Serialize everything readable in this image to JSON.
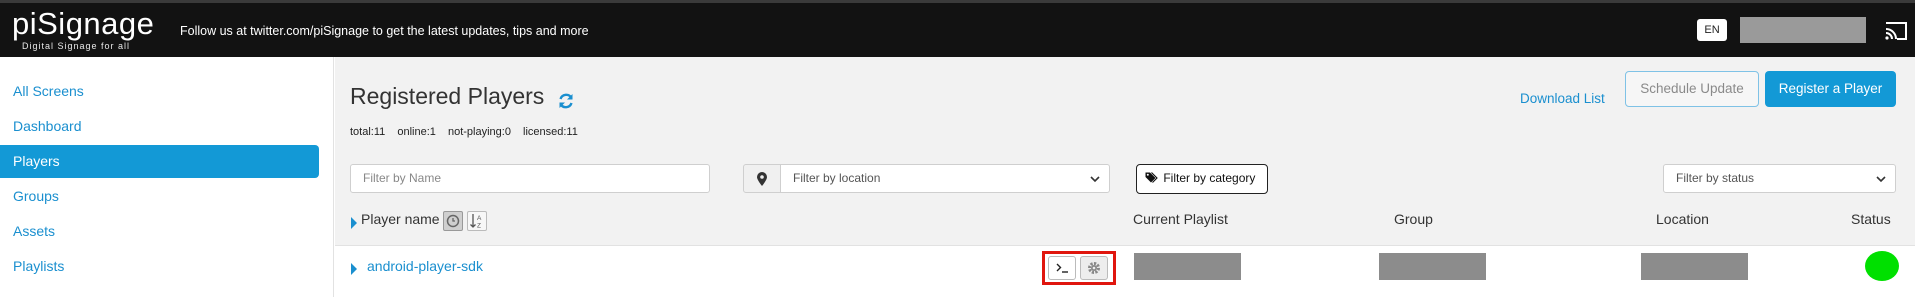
{
  "header": {
    "logo_main": "piSignage",
    "logo_sub": "Digital Signage for all",
    "follow_text": "Follow us at twitter.com/piSignage to get the latest updates, tips and more",
    "language": "EN",
    "cast_icon": "cast-icon"
  },
  "sidebar": {
    "items": [
      {
        "label": "All Screens"
      },
      {
        "label": "Dashboard"
      },
      {
        "label": "Players",
        "active": true
      },
      {
        "label": "Groups"
      },
      {
        "label": "Assets"
      },
      {
        "label": "Playlists"
      }
    ]
  },
  "main": {
    "title": "Registered Players",
    "refresh_icon": "refresh-icon",
    "stats": {
      "total": "total:11",
      "online": "online:1",
      "not_playing": "not-playing:0",
      "licensed": "licensed:11"
    },
    "download_list": "Download List",
    "schedule_update": "Schedule Update",
    "register_player": "Register a Player",
    "filters": {
      "name_placeholder": "Filter by Name",
      "location": "Filter by location",
      "category": "Filter by category",
      "status": "Filter by status"
    },
    "columns": {
      "player_name": "Player name",
      "current_playlist": "Current Playlist",
      "group": "Group",
      "location": "Location",
      "status": "Status"
    },
    "rows": [
      {
        "name": "android-player-sdk",
        "status_color": "#00e000"
      }
    ]
  },
  "colors": {
    "accent": "#1399d6",
    "topbar": "#121212",
    "highlight": "#e0160e",
    "online": "#00e000"
  }
}
